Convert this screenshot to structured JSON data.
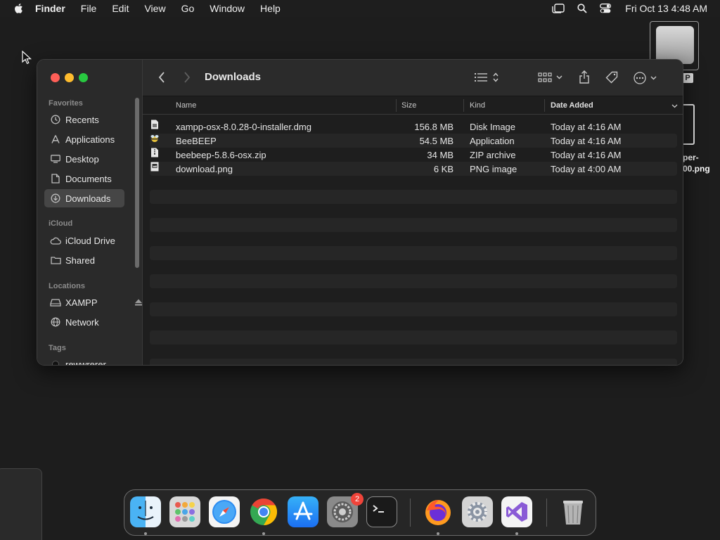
{
  "menubar": {
    "app_name": "Finder",
    "items": [
      "File",
      "Edit",
      "View",
      "Go",
      "Window",
      "Help"
    ],
    "clock": "Fri Oct 13  4:48 AM"
  },
  "desktop": {
    "file_label_line1": "per-",
    "file_label_line2": "00.png",
    "drive_badge": "P"
  },
  "window": {
    "title": "Downloads",
    "sidebar": {
      "sections": {
        "favorites": "Favorites",
        "icloud": "iCloud",
        "locations": "Locations",
        "tags": "Tags"
      },
      "favorites": [
        {
          "label": "Recents",
          "icon": "clock-icon"
        },
        {
          "label": "Applications",
          "icon": "applications-icon"
        },
        {
          "label": "Desktop",
          "icon": "desktop-icon"
        },
        {
          "label": "Documents",
          "icon": "document-icon"
        },
        {
          "label": "Downloads",
          "icon": "download-icon",
          "active": true
        }
      ],
      "icloud": [
        {
          "label": "iCloud Drive",
          "icon": "cloud-icon"
        },
        {
          "label": "Shared",
          "icon": "shared-folder-icon"
        }
      ],
      "locations": [
        {
          "label": "XAMPP",
          "icon": "drive-icon"
        },
        {
          "label": "Network",
          "icon": "globe-icon"
        }
      ],
      "tags": [
        {
          "label": "rewwrerer",
          "icon": "tag-dot-icon"
        }
      ]
    },
    "columns": {
      "name": "Name",
      "size": "Size",
      "kind": "Kind",
      "date": "Date Added"
    },
    "files": [
      {
        "name": "xampp-osx-8.0.28-0-installer.dmg",
        "size": "156.8 MB",
        "kind": "Disk Image",
        "date": "Today at 4:16 AM"
      },
      {
        "name": "BeeBEEP",
        "size": "54.5 MB",
        "kind": "Application",
        "date": "Today at 4:16 AM"
      },
      {
        "name": "beebeep-5.8.6-osx.zip",
        "size": "34 MB",
        "kind": "ZIP archive",
        "date": "Today at 4:16 AM"
      },
      {
        "name": "download.png",
        "size": "6 KB",
        "kind": "PNG image",
        "date": "Today at 4:00 AM"
      }
    ]
  },
  "dock": {
    "settings_badge": "2",
    "apps": [
      "finder",
      "launchpad",
      "safari",
      "chrome",
      "app-store",
      "system-settings",
      "terminal",
      "firefox",
      "system-preferences",
      "visual-studio",
      "trash"
    ]
  }
}
